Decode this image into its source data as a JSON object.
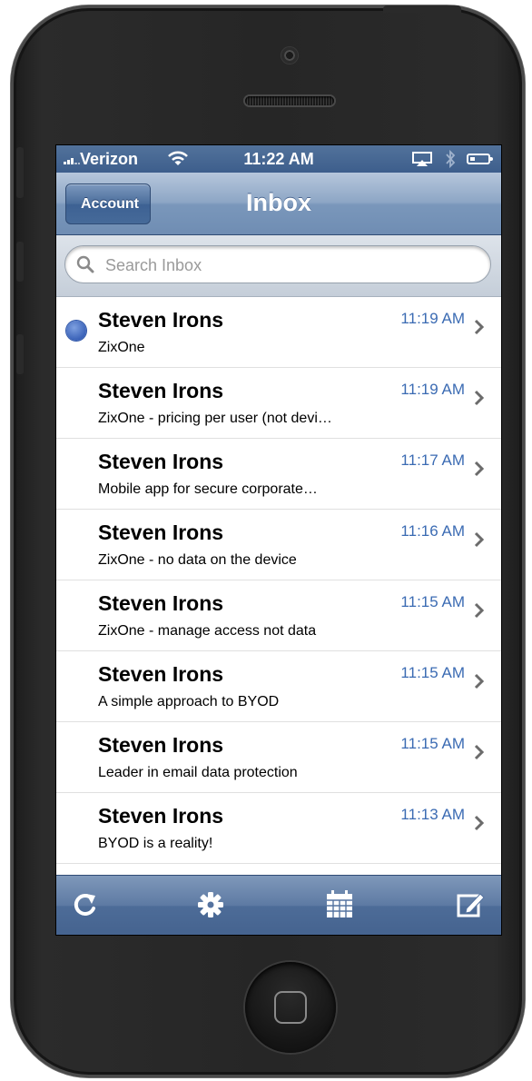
{
  "status_bar": {
    "carrier": "Verizon",
    "time": "11:22 AM"
  },
  "nav": {
    "back_label": "Account",
    "title": "Inbox"
  },
  "search": {
    "placeholder": "Search Inbox"
  },
  "messages": [
    {
      "sender": "Steven Irons",
      "subject": "ZixOne",
      "time": "11:19 AM",
      "unread": true
    },
    {
      "sender": "Steven Irons",
      "subject": "ZixOne - pricing per user (not devi…",
      "time": "11:19 AM",
      "unread": false
    },
    {
      "sender": "Steven Irons",
      "subject": "Mobile app for secure corporate…",
      "time": "11:17 AM",
      "unread": false
    },
    {
      "sender": "Steven Irons",
      "subject": "ZixOne - no data on the device",
      "time": "11:16 AM",
      "unread": false
    },
    {
      "sender": "Steven Irons",
      "subject": "ZixOne - manage access not data",
      "time": "11:15 AM",
      "unread": false
    },
    {
      "sender": "Steven Irons",
      "subject": "A simple approach to BYOD",
      "time": "11:15 AM",
      "unread": false
    },
    {
      "sender": "Steven Irons",
      "subject": "Leader in email data protection",
      "time": "11:15 AM",
      "unread": false
    },
    {
      "sender": "Steven Irons",
      "subject": "BYOD is a reality!",
      "time": "11:13 AM",
      "unread": false
    }
  ],
  "toolbar": {
    "icons": [
      "refresh-icon",
      "gear-icon",
      "calendar-icon",
      "compose-icon"
    ]
  },
  "colors": {
    "accent_blue": "#3b6bb3",
    "nav_bar": "#7a97bb",
    "status_bar": "#3d5e8c",
    "unread_dot": "#3a62b8"
  }
}
